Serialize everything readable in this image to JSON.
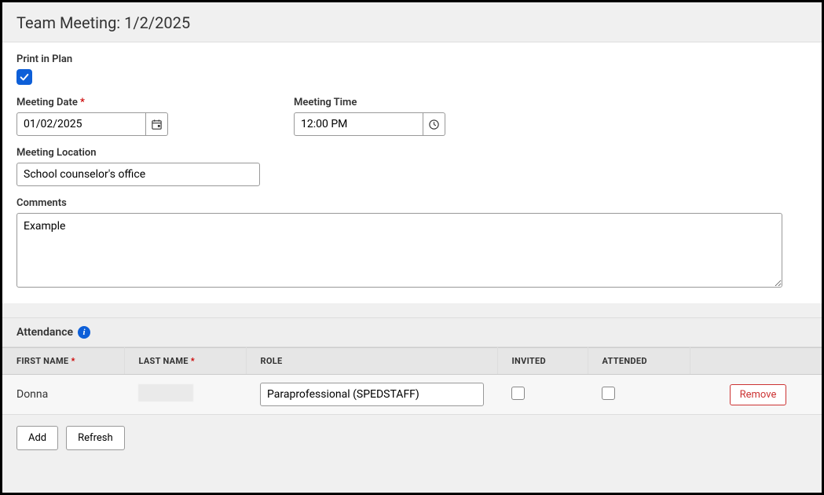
{
  "header": {
    "title": "Team Meeting: 1/2/2025"
  },
  "form": {
    "print_in_plan_label": "Print in Plan",
    "print_in_plan_checked": true,
    "meeting_date_label": "Meeting Date",
    "meeting_date_value": "01/02/2025",
    "meeting_time_label": "Meeting Time",
    "meeting_time_value": "12:00 PM",
    "meeting_location_label": "Meeting Location",
    "meeting_location_value": "School counselor's office",
    "comments_label": "Comments",
    "comments_value": "Example"
  },
  "attendance": {
    "section_label": "Attendance",
    "columns": {
      "first_name": "FIRST NAME",
      "last_name": "LAST NAME",
      "role": "ROLE",
      "invited": "INVITED",
      "attended": "ATTENDED"
    },
    "rows": [
      {
        "first_name": "Donna",
        "last_name": "",
        "role": "Paraprofessional (SPEDSTAFF)",
        "invited": false,
        "attended": false,
        "remove_label": "Remove"
      }
    ],
    "add_label": "Add",
    "refresh_label": "Refresh"
  }
}
